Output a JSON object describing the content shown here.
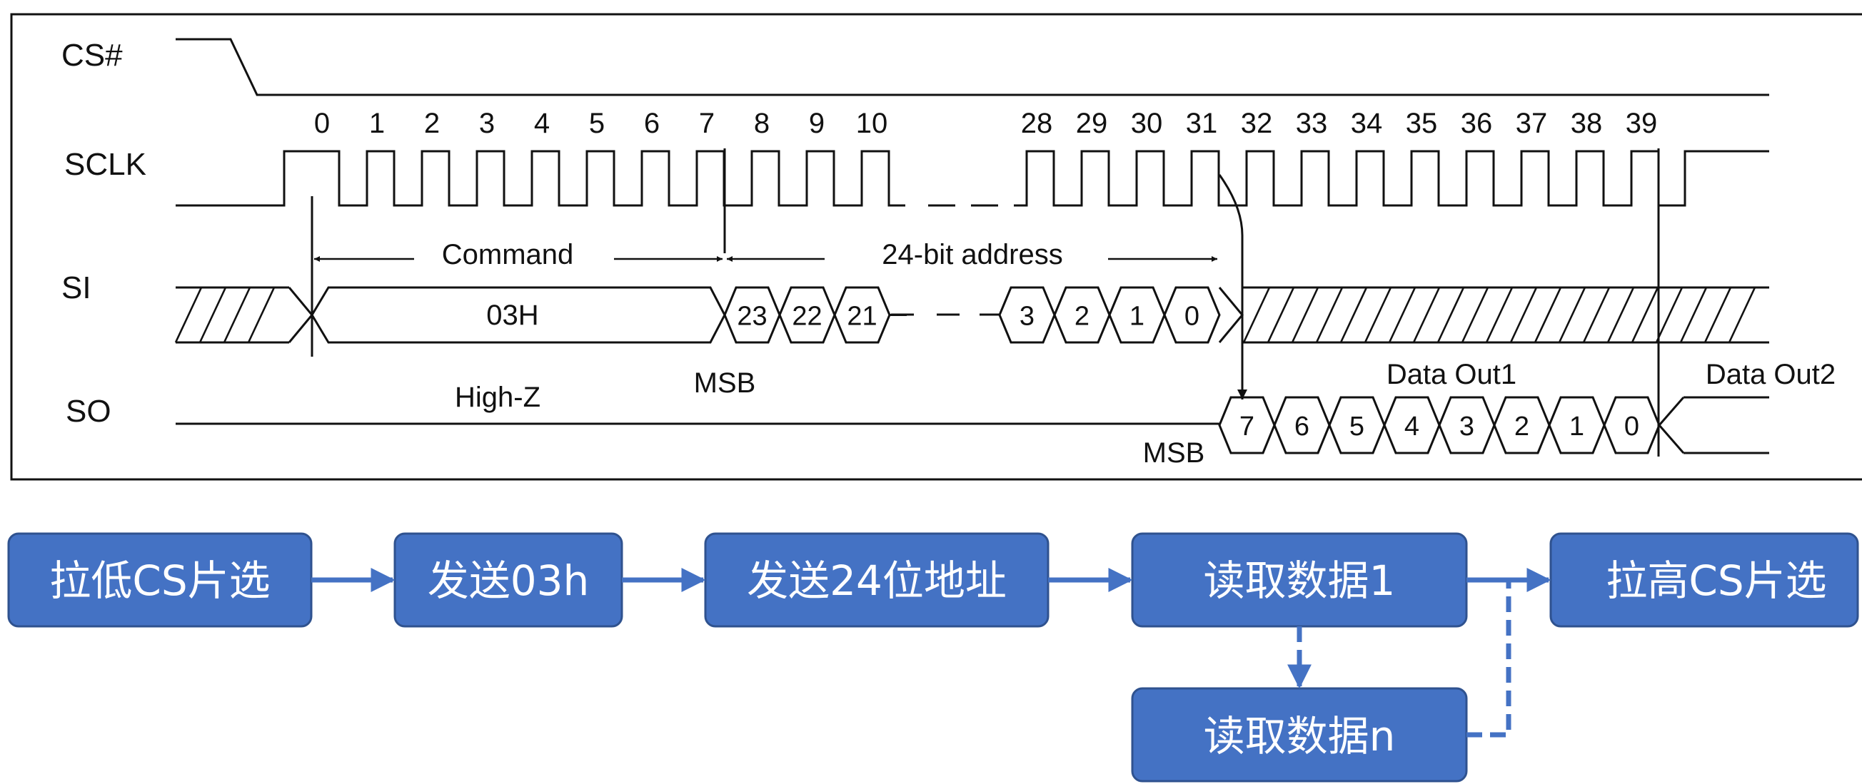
{
  "timing": {
    "signals": {
      "cs": "CS#",
      "sclk": "SCLK",
      "si": "SI",
      "so": "SO"
    },
    "clock_numbers": [
      "0",
      "1",
      "2",
      "3",
      "4",
      "5",
      "6",
      "7",
      "8",
      "9",
      "10",
      "28",
      "29",
      "30",
      "31",
      "32",
      "33",
      "34",
      "35",
      "36",
      "37",
      "38",
      "39"
    ],
    "command_label": "Command",
    "address_label": "24-bit address",
    "command_value": "03H",
    "address_bits_high": [
      "23",
      "22",
      "21"
    ],
    "address_bits_low": [
      "3",
      "2",
      "1",
      "0"
    ],
    "msb_si": "MSB",
    "high_z": "High-Z",
    "data_out1": "Data Out1",
    "data_out2": "Data Out2",
    "data_bits": [
      "7",
      "6",
      "5",
      "4",
      "3",
      "2",
      "1",
      "0"
    ],
    "msb_so": "MSB"
  },
  "flow": {
    "step1": "拉低CS片选",
    "step2": "发送03h",
    "step3": "发送24位地址",
    "step4": "读取数据1",
    "step5": "拉高CS片选",
    "step6": "读取数据n"
  },
  "colors": {
    "box_fill": "#4472c4",
    "box_border": "#2f528f",
    "arrow": "#4472c4"
  }
}
